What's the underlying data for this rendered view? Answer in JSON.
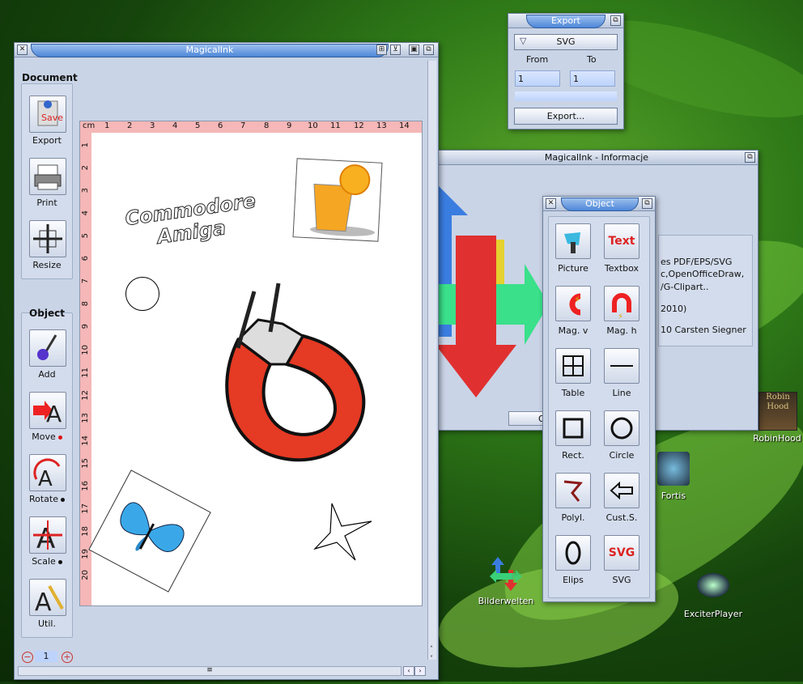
{
  "main_window": {
    "title": "MagicalInk",
    "document_group_label": "Document",
    "document_tools": [
      {
        "label": "Export",
        "icon": "save-export-icon"
      },
      {
        "label": "Print",
        "icon": "printer-icon"
      },
      {
        "label": "Resize",
        "icon": "resize-icon"
      }
    ],
    "object_group_label": "Object",
    "object_tools": [
      {
        "label": "Add",
        "icon": "add-pen-icon"
      },
      {
        "label": "Move",
        "icon": "move-arrow-icon",
        "dot_color": "#d11"
      },
      {
        "label": "Rotate",
        "icon": "rotate-icon",
        "dot_color": "#111"
      },
      {
        "label": "Scale",
        "icon": "scale-icon",
        "dot_color": "#111"
      },
      {
        "label": "Util.",
        "icon": "utility-tools-icon"
      }
    ],
    "page_number": "1",
    "ruler_unit": "cm",
    "ruler_h": [
      "1",
      "2",
      "3",
      "4",
      "5",
      "6",
      "7",
      "8",
      "9",
      "10",
      "11",
      "12",
      "13",
      "14"
    ],
    "ruler_v": [
      "1",
      "2",
      "3",
      "4",
      "5",
      "6",
      "7",
      "8",
      "9",
      "10",
      "11",
      "12",
      "13",
      "14",
      "15",
      "16",
      "17",
      "18",
      "19",
      "20"
    ],
    "canvas_text": [
      "Commodore",
      "Amiga"
    ]
  },
  "export_window": {
    "title": "Export",
    "format": "SVG",
    "from_label": "From",
    "to_label": "To",
    "from_value": "1",
    "to_value": "1",
    "export_button": "Export..."
  },
  "info_window": {
    "title": "MagicalInk - Informacje",
    "lines": [
      "es PDF/EPS/SVG",
      "c,OpenOfficeDraw,",
      "/G-Clipart..",
      "2010)",
      "10 Carsten Siegner"
    ],
    "button_partial": "O"
  },
  "object_window": {
    "title": "Object",
    "items": [
      {
        "label": "Picture",
        "icon": "picture-icon"
      },
      {
        "label": "Textbox",
        "icon": "textbox-icon",
        "text": "Text"
      },
      {
        "label": "Mag. v",
        "icon": "magnet-vertical-icon"
      },
      {
        "label": "Mag. h",
        "icon": "magnet-horizontal-icon"
      },
      {
        "label": "Table",
        "icon": "table-icon"
      },
      {
        "label": "Line",
        "icon": "line-icon"
      },
      {
        "label": "Rect.",
        "icon": "rectangle-icon"
      },
      {
        "label": "Circle",
        "icon": "circle-icon"
      },
      {
        "label": "Polyl.",
        "icon": "polyline-icon"
      },
      {
        "label": "Cust.S.",
        "icon": "custom-shape-icon"
      },
      {
        "label": "Elips",
        "icon": "ellipse-icon"
      },
      {
        "label": "SVG",
        "icon": "svg-icon",
        "text": "SVG"
      }
    ]
  },
  "desktop_icons": [
    {
      "label": "RobinHood",
      "art_text": "Robin Hood"
    },
    {
      "label": "Fortis"
    },
    {
      "label": "Bilderwelten"
    },
    {
      "label": "ExciterPlayer"
    }
  ]
}
